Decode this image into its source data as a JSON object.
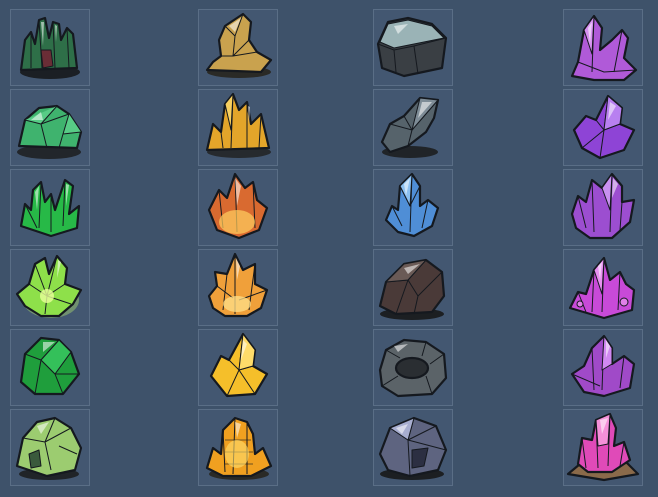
{
  "grid": {
    "columns": [
      {
        "name": "green",
        "items": [
          {
            "icon": "dark-emerald-cluster-icon",
            "color": "#2f7a4f"
          },
          {
            "icon": "jade-crystal-rock-icon",
            "color": "#3fb36e"
          },
          {
            "icon": "emerald-shard-cluster-icon",
            "color": "#28c04a"
          },
          {
            "icon": "glowing-peridot-cluster-icon",
            "color": "#8ee04a"
          },
          {
            "icon": "emerald-chunk-icon",
            "color": "#1f9e3c"
          },
          {
            "icon": "lime-ore-rock-icon",
            "color": "#9ccc70"
          }
        ]
      },
      {
        "name": "gold",
        "items": [
          {
            "icon": "sandstone-shard-icon",
            "color": "#c9a24e"
          },
          {
            "icon": "citrine-cluster-icon",
            "color": "#e3a52a"
          },
          {
            "icon": "fire-opal-crystal-icon",
            "color": "#d96a30"
          },
          {
            "icon": "amber-cluster-icon",
            "color": "#f0a03a"
          },
          {
            "icon": "topaz-crystal-icon",
            "color": "#f5bf2a"
          },
          {
            "icon": "glowing-amber-crystal-icon",
            "color": "#f0a020"
          }
        ]
      },
      {
        "name": "stone",
        "items": [
          {
            "icon": "frosted-stone-ore-icon",
            "color": "#8ea6aa"
          },
          {
            "icon": "slate-shard-icon",
            "color": "#56636b"
          },
          {
            "icon": "sapphire-cluster-icon",
            "color": "#4f8ed6"
          },
          {
            "icon": "obsidian-ore-icon",
            "color": "#4a3a38"
          },
          {
            "icon": "hollow-stone-ring-icon",
            "color": "#5b6368"
          },
          {
            "icon": "iron-ore-rock-icon",
            "color": "#7a80a8"
          }
        ]
      },
      {
        "name": "purple",
        "items": [
          {
            "icon": "amethyst-cluster-icon",
            "color": "#b05ad8"
          },
          {
            "icon": "amethyst-crystal-icon",
            "color": "#8e44d6"
          },
          {
            "icon": "amethyst-geode-cluster-icon",
            "color": "#9c4ed0"
          },
          {
            "icon": "magenta-crystal-cluster-icon",
            "color": "#c84ad8"
          },
          {
            "icon": "violet-shard-cluster-icon",
            "color": "#a04ac8"
          },
          {
            "icon": "pink-crystal-on-dirt-icon",
            "color": "#e04ab8"
          }
        ]
      }
    ]
  }
}
